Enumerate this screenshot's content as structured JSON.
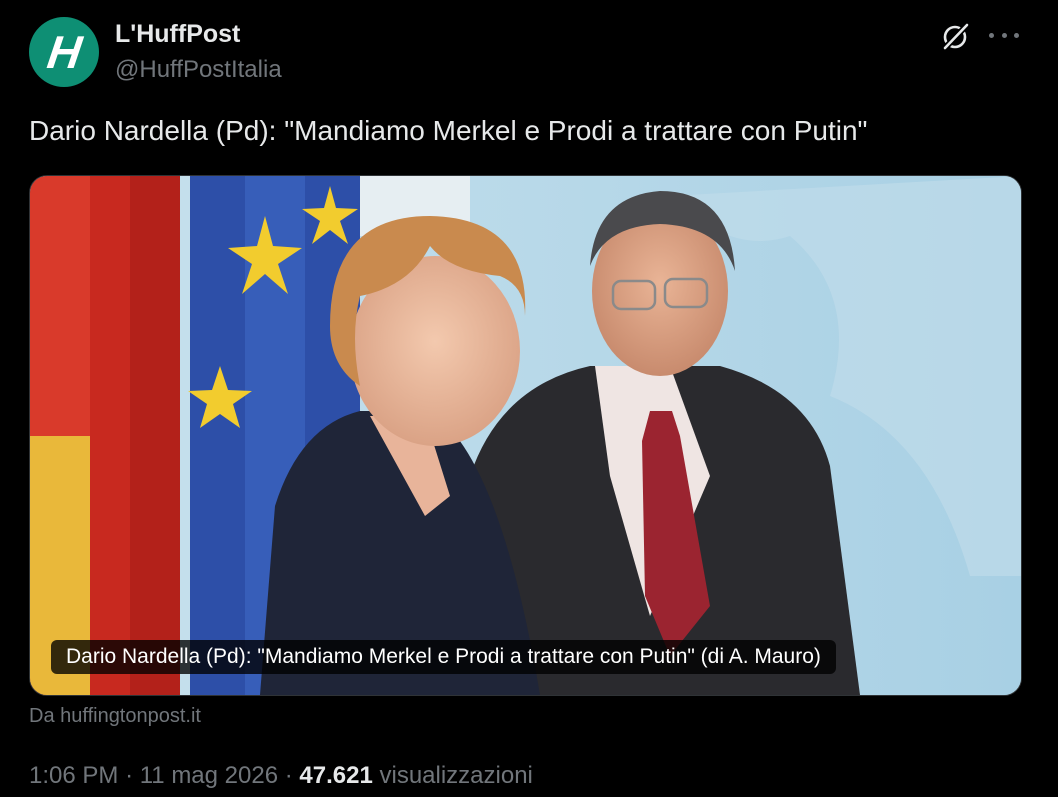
{
  "author": {
    "avatar_letter": "H",
    "display_name": "L'HuffPost",
    "handle": "@HuffPostItalia",
    "avatar_color": "#0e8f74"
  },
  "header_icons": {
    "grok": "grok-icon",
    "more": "more-icon"
  },
  "tweet": {
    "text": "Dario Nardella (Pd): \"Mandiamo Merkel e Prodi a trattare con Putin\""
  },
  "card": {
    "caption": "Dario Nardella (Pd): \"Mandiamo Merkel e Prodi a trattare con Putin\" (di A. Mauro)",
    "source": "Da huffingtonpost.it"
  },
  "meta": {
    "time": "1:06 PM",
    "separator1": "·",
    "date": "11 mag 2026",
    "separator2": "·",
    "views_count": "47.621",
    "views_label": "visualizzazioni"
  },
  "colors": {
    "background": "#000000",
    "text_primary": "#e7e9ea",
    "text_secondary": "#71767b"
  }
}
